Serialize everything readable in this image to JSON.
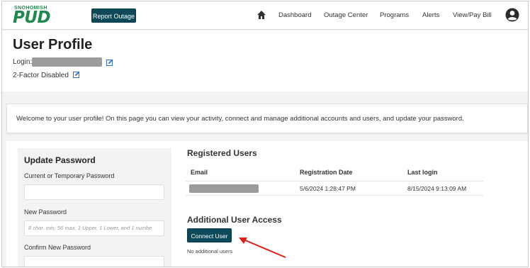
{
  "header": {
    "logo_small": "SNOHOMISH",
    "logo_big": "PUD",
    "report_outage": "Report Outage",
    "nav": [
      "Dashboard",
      "Outage Center",
      "Programs",
      "Alerts",
      "View/Pay Bill"
    ]
  },
  "profile": {
    "title": "User Profile",
    "login_label": "Login:",
    "two_factor": "2-Factor Disabled"
  },
  "welcome": "Welcome to your user profile! On this page you can view your activity, connect and manage additional accounts and users, and update your password.",
  "password": {
    "title": "Update Password",
    "current_label": "Current or Temporary Password",
    "current_value": "",
    "new_label": "New Password",
    "new_placeholder": "8 char. min, 56 max; 1 Upper, 1 Lower, and 1 numbe",
    "confirm_label": "Confirm New Password",
    "confirm_value": ""
  },
  "registered": {
    "title": "Registered Users",
    "columns": [
      "Email",
      "Registration Date",
      "Last login"
    ],
    "rows": [
      {
        "registration_date": "5/6/2024 1:28:47 PM",
        "last_login": "8/15/2024 9:13:09 AM"
      }
    ]
  },
  "additional": {
    "title": "Additional User Access",
    "connect_button": "Connect User",
    "empty_text": "No additional users"
  },
  "colors": {
    "brand_green": "#1f8a4c",
    "button_teal": "#0c4a5a",
    "annotation_red": "#e0201c"
  }
}
